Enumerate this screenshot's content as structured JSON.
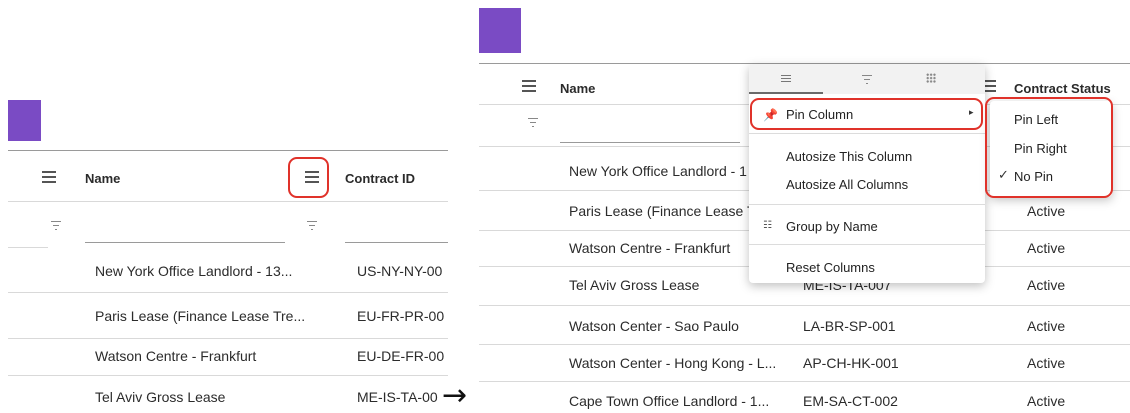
{
  "left": {
    "columns": {
      "name": "Name",
      "contract_id": "Contract ID"
    },
    "rows": [
      {
        "name": "New York Office Landlord - 13...",
        "id": "US-NY-NY-00"
      },
      {
        "name": "Paris Lease (Finance Lease Tre...",
        "id": "EU-FR-PR-00"
      },
      {
        "name": "Watson Centre - Frankfurt",
        "id": "EU-DE-FR-00"
      },
      {
        "name": "Tel Aviv Gross Lease",
        "id": "ME-IS-TA-00"
      }
    ]
  },
  "arrow": "→",
  "right": {
    "columns": {
      "name": "Name",
      "contract_status": "Contract Status"
    },
    "rows": [
      {
        "name": "New York Office Landlord - 1",
        "status": ""
      },
      {
        "name": "Paris Lease (Finance Lease T",
        "status": "Active"
      },
      {
        "name": "Watson Centre - Frankfurt",
        "status": "Active"
      },
      {
        "name": "Tel Aviv Gross Lease",
        "id": "ME-IS-TA-007",
        "status": "Active"
      },
      {
        "name": "Watson Center - Sao Paulo",
        "id": "LA-BR-SP-001",
        "status": "Active"
      },
      {
        "name": "Watson Center - Hong Kong - L...",
        "id": "AP-CH-HK-001",
        "status": "Active"
      },
      {
        "name": "Cape Town Office Landlord - 1...",
        "id": "EM-SA-CT-002",
        "status": "Active"
      }
    ],
    "column_menu": {
      "pin_column": "Pin Column",
      "autosize_this": "Autosize This Column",
      "autosize_all": "Autosize All Columns",
      "group_by": "Group by Name",
      "reset": "Reset Columns"
    },
    "pin_submenu": {
      "pin_left": "Pin Left",
      "pin_right": "Pin Right",
      "no_pin": "No Pin",
      "checkmark": "✓"
    }
  },
  "colors": {
    "accent": "#7a4bc4",
    "highlight": "#e0322a"
  }
}
